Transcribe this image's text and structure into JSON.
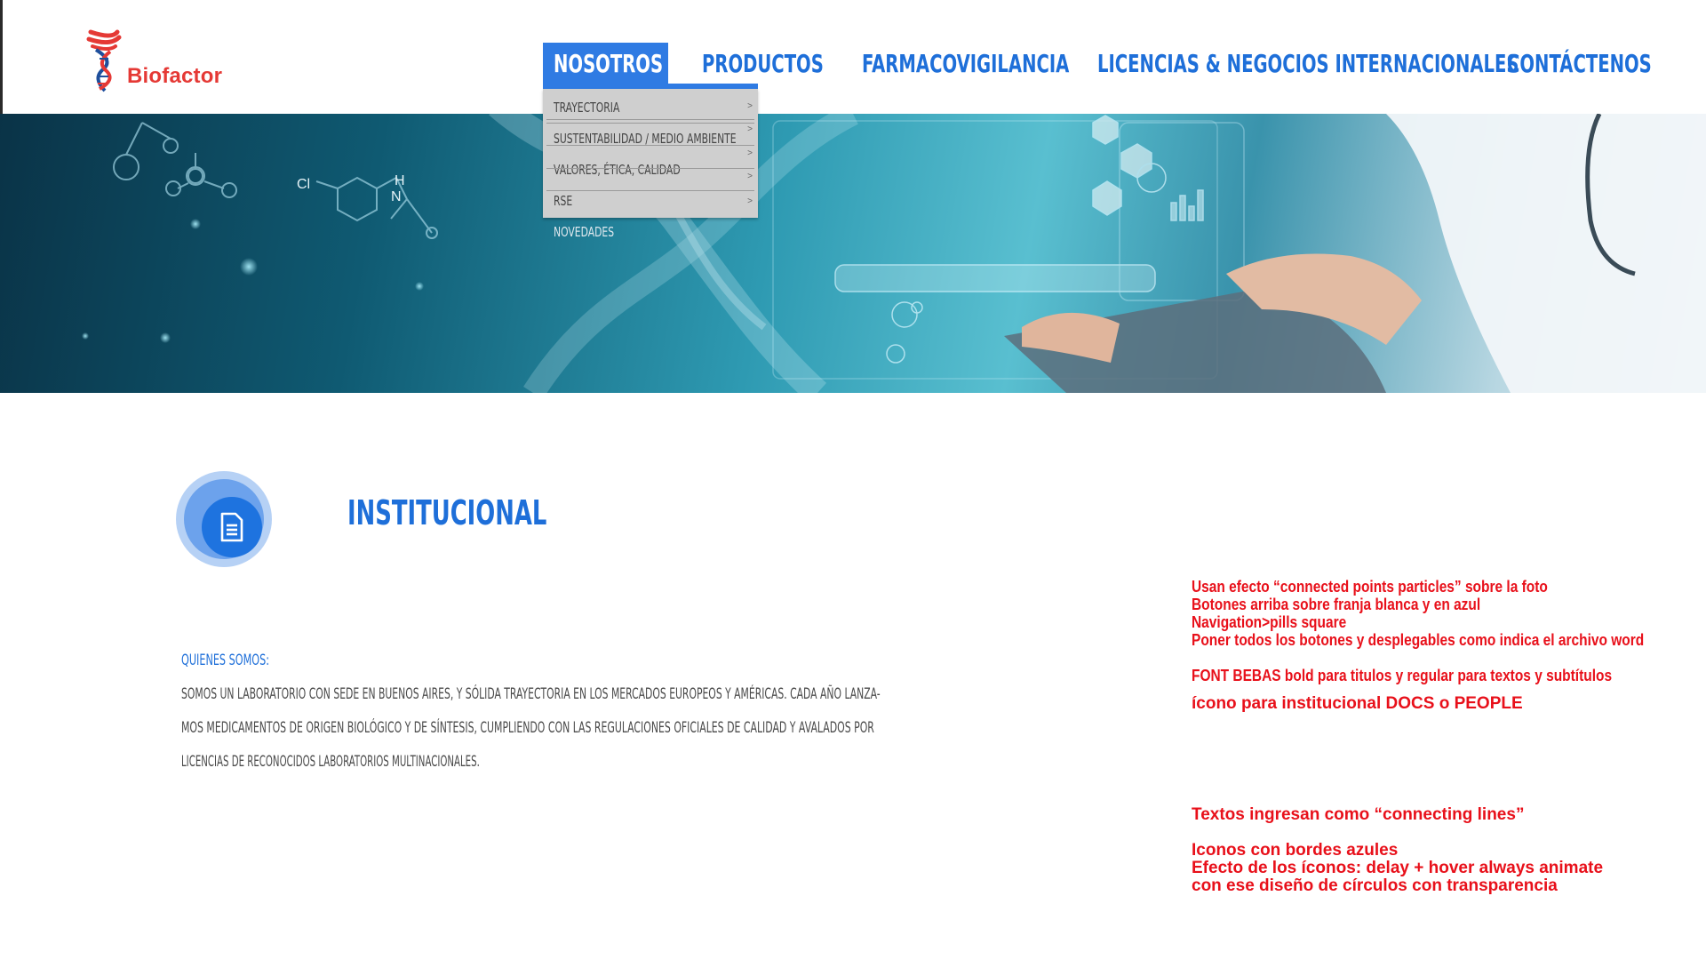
{
  "brand": {
    "name": "Biofactor",
    "logo_icon": "dna-icon",
    "colors": {
      "primary": "#1e6fd9",
      "accent": "#2f7be3",
      "logo_red": "#e53935",
      "note_red": "#e8101a"
    }
  },
  "nav": {
    "items": [
      {
        "label": "NOSOTROS",
        "active": true
      },
      {
        "label": "PRODUCTOS"
      },
      {
        "label": "FARMACOVIGILANCIA"
      },
      {
        "label": "LICENCIAS & NEGOCIOS INTERNACIONALES"
      },
      {
        "label": "CONTÁCTENOS"
      }
    ]
  },
  "dropdown": {
    "items": [
      {
        "label": "TRAYECTORIA",
        "arrow": ">"
      },
      {
        "label": "SUSTENTABILIDAD / MEDIO AMBIENTE",
        "arrow": ">"
      },
      {
        "label": "VALORES, ÉTICA, CALIDAD",
        "arrow": ">"
      },
      {
        "label": "RSE",
        "arrow": ">"
      },
      {
        "label": "NOVEDADES"
      }
    ],
    "extra_arrow": ">"
  },
  "hero": {
    "molecule_labels": [
      "Cl",
      "H",
      "N"
    ]
  },
  "section": {
    "icon": "document-icon",
    "title": "INSTITUCIONAL",
    "subtitle": "QUIENES SOMOS:",
    "body_lines": [
      "SOMOS UN LABORATORIO CON SEDE EN BUENOS AIRES, Y SÓLIDA TRAYECTORIA EN LOS MERCADOS EUROPEOS Y AMÉRICAS. CADA AÑO LANZA-",
      "MOS MEDICAMENTOS DE ORIGEN BIOLÓGICO Y DE SÍNTESIS, CUMPLIENDO CON LAS REGULACIONES OFICIALES DE CALIDAD Y AVALADOS POR",
      "LICENCIAS DE RECONOCIDOS LABORATORIOS MULTINACIONALES."
    ]
  },
  "notes": [
    "Usan efecto “connected points particles” sobre la foto",
    "Botones arriba sobre franja blanca y en azul",
    "Navigation>pills square",
    "Poner todos los botones y desplegables como indica el archivo word",
    "FONT BEBAS bold para titulos y regular para textos y subtítulos",
    "ícono para institucional DOCS o PEOPLE",
    "Textos ingresan como “connecting lines”",
    "Iconos con bordes azules",
    "Efecto de los íconos: delay + hover always animate",
    "con ese diseño de círculos con transparencia"
  ]
}
